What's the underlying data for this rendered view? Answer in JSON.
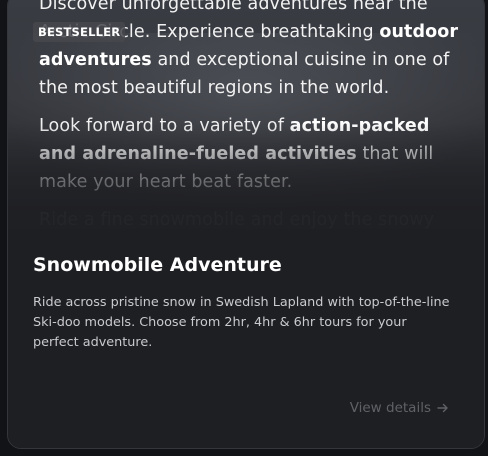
{
  "card": {
    "badge": "BESTSELLER",
    "hero": {
      "paragraphs": [
        {
          "segments": [
            {
              "text": "Discover unforgettable adventures near the Arctic Circle. Experience breathtaking ",
              "bold": false
            },
            {
              "text": "outdoor adventures",
              "bold": true
            },
            {
              "text": " and exceptional cuisine in one of the most beautiful regions in the world.",
              "bold": false
            }
          ]
        },
        {
          "segments": [
            {
              "text": "Look forward to a variety of ",
              "bold": false
            },
            {
              "text": "action-packed and adrenaline-fueled activities",
              "bold": true
            },
            {
              "text": " that will make your heart beat faster.",
              "bold": false
            }
          ]
        },
        {
          "segments": [
            {
              "text": "Ride a fine snowmobile and enjoy the snowy wonderland.",
              "bold": false
            }
          ]
        }
      ]
    },
    "title": "Snowmobile Adventure",
    "description": "Ride across pristine snow in Swedish Lapland with top-of-the-line Ski-doo models. Choose from 2hr, 4hr & 6hr tours for your perfect adventure.",
    "cta": {
      "label": "View details",
      "icon": "arrow-right-icon"
    }
  },
  "colors": {
    "background": "#121316",
    "card": "#1e1f23",
    "title": "#ffffff",
    "description": "#c9cacd",
    "cta": "#5f6166"
  }
}
